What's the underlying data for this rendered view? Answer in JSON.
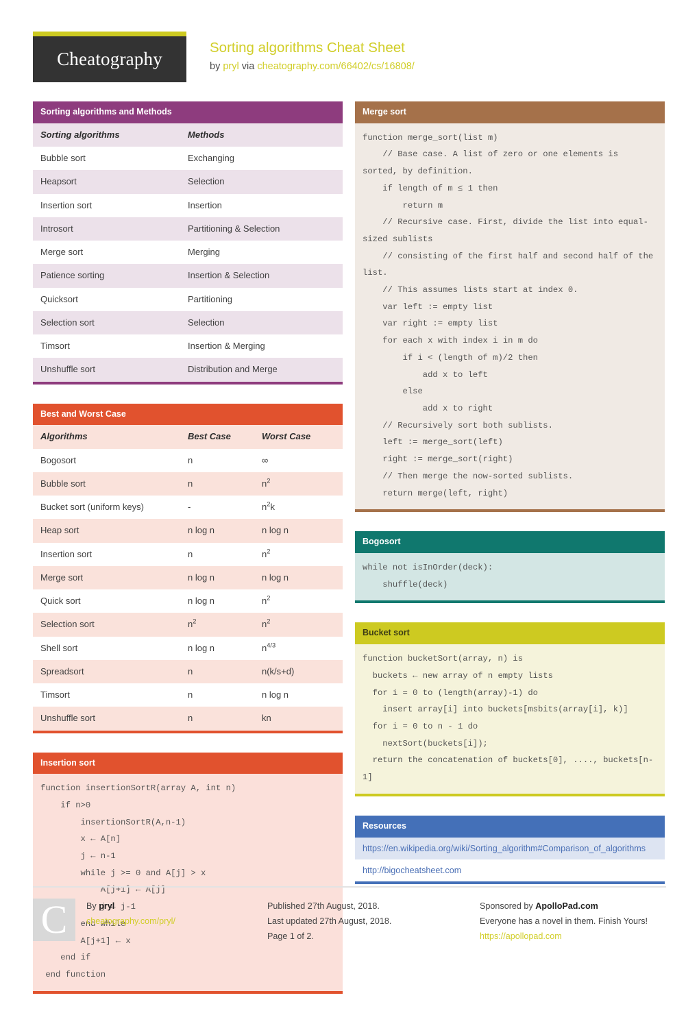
{
  "header": {
    "logo_text": "Cheatography",
    "title": "Sorting algorithms Cheat Sheet",
    "by_prefix": "by ",
    "author": "pryl",
    "via": " via ",
    "source_url": "cheatography.com/66402/cs/16808/"
  },
  "colors": {
    "brand_yellow": "#d1ce29",
    "purple": "#8e3c7e",
    "orange": "#e1522e",
    "brown": "#a5714a",
    "teal": "#10786e",
    "yellow": "#cdca21",
    "blue": "#4470b8",
    "logo_dark": "#333333"
  },
  "sections": {
    "sorting_methods": {
      "title": "Sorting algorithms and Methods",
      "columns": [
        "Sorting algorithms",
        "Methods"
      ],
      "rows": [
        [
          "Bubble sort",
          "Exchanging"
        ],
        [
          "Heapsort",
          "Selection"
        ],
        [
          "Insertion sort",
          "Insertion"
        ],
        [
          "Introsort",
          "Partitioning & Selection"
        ],
        [
          "Merge sort",
          "Merging"
        ],
        [
          "Patience sorting",
          "Insertion & Selection"
        ],
        [
          "Quicksort",
          "Partitioning"
        ],
        [
          "Selection sort",
          "Selection"
        ],
        [
          "Timsort",
          "Insertion & Merging"
        ],
        [
          "Unshuffle sort",
          "Distribution and Merge"
        ]
      ]
    },
    "best_worst": {
      "title": "Best and Worst Case",
      "columns": [
        "Algorithms",
        "Best Case",
        "Worst Case"
      ],
      "rows": [
        {
          "name": "Bogosort",
          "best": "n",
          "best_sup": "",
          "worst": "∞",
          "worst_sup": "",
          "worst_tail": ""
        },
        {
          "name": "Bubble sort",
          "best": "n",
          "best_sup": "",
          "worst": "n",
          "worst_sup": "2",
          "worst_tail": ""
        },
        {
          "name": "Bucket sort (uniform keys)",
          "best": "-",
          "best_sup": "",
          "worst": "n",
          "worst_sup": "2",
          "worst_tail": "k"
        },
        {
          "name": "Heap sort",
          "best": "n log n",
          "best_sup": "",
          "worst": "n log n",
          "worst_sup": "",
          "worst_tail": ""
        },
        {
          "name": "Insertion sort",
          "best": "n",
          "best_sup": "",
          "worst": "n",
          "worst_sup": "2",
          "worst_tail": ""
        },
        {
          "name": "Merge sort",
          "best": "n log n",
          "best_sup": "",
          "worst": "n log n",
          "worst_sup": "",
          "worst_tail": ""
        },
        {
          "name": "Quick sort",
          "best": "n log n",
          "best_sup": "",
          "worst": "n",
          "worst_sup": "2",
          "worst_tail": ""
        },
        {
          "name": "Selection sort",
          "best": "n",
          "best_sup": "2",
          "worst": "n",
          "worst_sup": "2",
          "worst_tail": ""
        },
        {
          "name": "Shell sort",
          "best": "n log n",
          "best_sup": "",
          "worst": "n",
          "worst_sup": "4/3",
          "worst_tail": ""
        },
        {
          "name": "Spreadsort",
          "best": "n",
          "best_sup": "",
          "worst": "n(k/s+d)",
          "worst_sup": "",
          "worst_tail": ""
        },
        {
          "name": "Timsort",
          "best": "n",
          "best_sup": "",
          "worst": "n log n",
          "worst_sup": "",
          "worst_tail": ""
        },
        {
          "name": "Unshuffle sort",
          "best": "n",
          "best_sup": "",
          "worst": "kn",
          "worst_sup": "",
          "worst_tail": ""
        }
      ]
    },
    "insertion_sort": {
      "title": "Insertion sort",
      "code": "function insertionSortR(array A, int n)\n    if n>0\n        insertionSortR(A,n-1)\n        x ← A[n]\n        j ← n-1\n        while j >= 0 and A[j] > x\n            A[j+1] ← A[j]\n            j ← j-1\n        end while\n        A[j+1] ← x\n    end if\n end function"
    },
    "merge_sort": {
      "title": "Merge sort",
      "code": "function merge_sort(list m)\n    // Base case. A list of zero or one elements is sorted, by definition.\n    if length of m ≤ 1 then\n        return m\n    // Recursive case. First, divide the list into equal-sized sublists\n    // consisting of the first half and second half of the list.\n    // This assumes lists start at index 0.\n    var left := empty list\n    var right := empty list\n    for each x with index i in m do\n        if i < (length of m)/2 then\n            add x to left\n        else\n            add x to right\n    // Recursively sort both sublists.\n    left := merge_sort(left)\n    right := merge_sort(right)\n    // Then merge the now-sorted sublists.\n    return merge(left, right)"
    },
    "bogosort": {
      "title": "Bogosort",
      "code": "while not isInOrder(deck):\n    shuffle(deck)"
    },
    "bucket_sort": {
      "title": "Bucket sort",
      "code": "function bucketSort(array, n) is\n  buckets ← new array of n empty lists\n  for i = 0 to (length(array)-1) do\n    insert array[i] into buckets[msbits(array[i], k)]\n  for i = 0 to n - 1 do\n    nextSort(buckets[i]);\n  return the concatenation of buckets[0], ...., buckets[n-1]"
    },
    "resources": {
      "title": "Resources",
      "links": [
        "https://en.wikipedia.org/wiki/Sorting_algorithm#Comparison_of_algorithms",
        "http://bigocheatsheet.com"
      ]
    }
  },
  "footer": {
    "badge_letter": "C",
    "by_label": "By ",
    "author": "pryl",
    "author_url": "cheatography.com/pryl/",
    "published": "Published 27th August, 2018.",
    "last_updated": "Last updated 27th August, 2018.",
    "page": "Page 1 of 2.",
    "sponsor_prefix": "Sponsored by ",
    "sponsor_name": "ApolloPad.com",
    "sponsor_tagline": "Everyone has a novel in them. Finish Yours!",
    "sponsor_url": "https://apollopad.com"
  }
}
